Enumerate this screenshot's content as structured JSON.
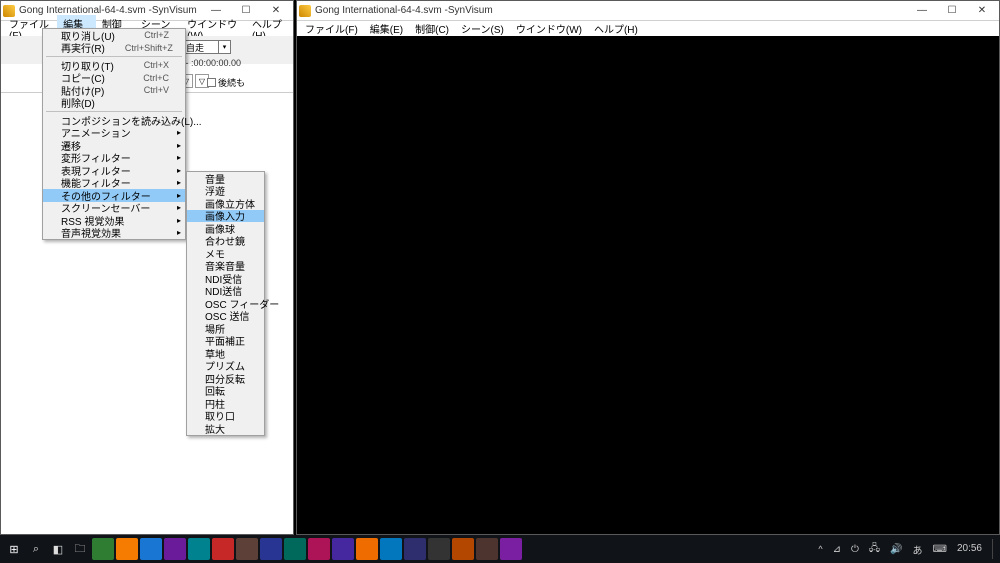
{
  "window_left": {
    "title": "Gong International-64-4.svm -SynVisum",
    "menubar": [
      "ファイル(F)",
      "編集(E)",
      "制御(C)",
      "シーン(S)",
      "ウインドウ(W)",
      "ヘルプ(H)"
    ],
    "combo_value": "自走",
    "timecode": ".00 - :00:00:00.00",
    "chk_label": "後続も"
  },
  "window_right": {
    "title": "Gong International-64-4.svm -SynVisum",
    "menubar": [
      "ファイル(F)",
      "編集(E)",
      "制御(C)",
      "シーン(S)",
      "ウインドウ(W)",
      "ヘルプ(H)"
    ]
  },
  "edit_menu": {
    "items": [
      {
        "label": "取り消し(U)",
        "accel": "Ctrl+Z"
      },
      {
        "label": "再実行(R)",
        "accel": "Ctrl+Shift+Z"
      },
      {
        "sep": true
      },
      {
        "label": "切り取り(T)",
        "accel": "Ctrl+X"
      },
      {
        "label": "コピー(C)",
        "accel": "Ctrl+C"
      },
      {
        "label": "貼付け(P)",
        "accel": "Ctrl+V"
      },
      {
        "label": "削除(D)"
      },
      {
        "sep": true
      },
      {
        "label": "コンポジションを読み込み(L)..."
      },
      {
        "label": "アニメーション",
        "sub": true
      },
      {
        "label": "遷移",
        "sub": true
      },
      {
        "label": "変形フィルター",
        "sub": true
      },
      {
        "label": "表現フィルター",
        "sub": true
      },
      {
        "label": "機能フィルター",
        "sub": true
      },
      {
        "label": "その他のフィルター",
        "sub": true,
        "hl": true
      },
      {
        "label": "スクリーンセーバー",
        "sub": true
      },
      {
        "label": "RSS 視覚効果",
        "sub": true
      },
      {
        "label": "音声視覚効果",
        "sub": true
      }
    ]
  },
  "submenu": {
    "items": [
      {
        "label": "音量"
      },
      {
        "label": "浮遊"
      },
      {
        "label": "画像立方体"
      },
      {
        "label": "画像入力",
        "hl": true
      },
      {
        "label": "画像球"
      },
      {
        "label": "合わせ鏡"
      },
      {
        "label": "メモ"
      },
      {
        "label": "音楽音量"
      },
      {
        "label": "NDI受信"
      },
      {
        "label": "NDI送信"
      },
      {
        "label": "OSC フィーダー"
      },
      {
        "label": "OSC 送信"
      },
      {
        "label": "場所"
      },
      {
        "label": "平面補正"
      },
      {
        "label": "草地"
      },
      {
        "label": "プリズム"
      },
      {
        "label": "四分反転"
      },
      {
        "label": "回転"
      },
      {
        "label": "円柱"
      },
      {
        "label": "取り口"
      },
      {
        "label": "拡大"
      }
    ]
  },
  "taskbar": {
    "time": "20:56",
    "ime": "あ",
    "sys_icons": [
      "^",
      "⊿",
      "⏻",
      "🖧",
      "🔊",
      "⌨"
    ]
  }
}
